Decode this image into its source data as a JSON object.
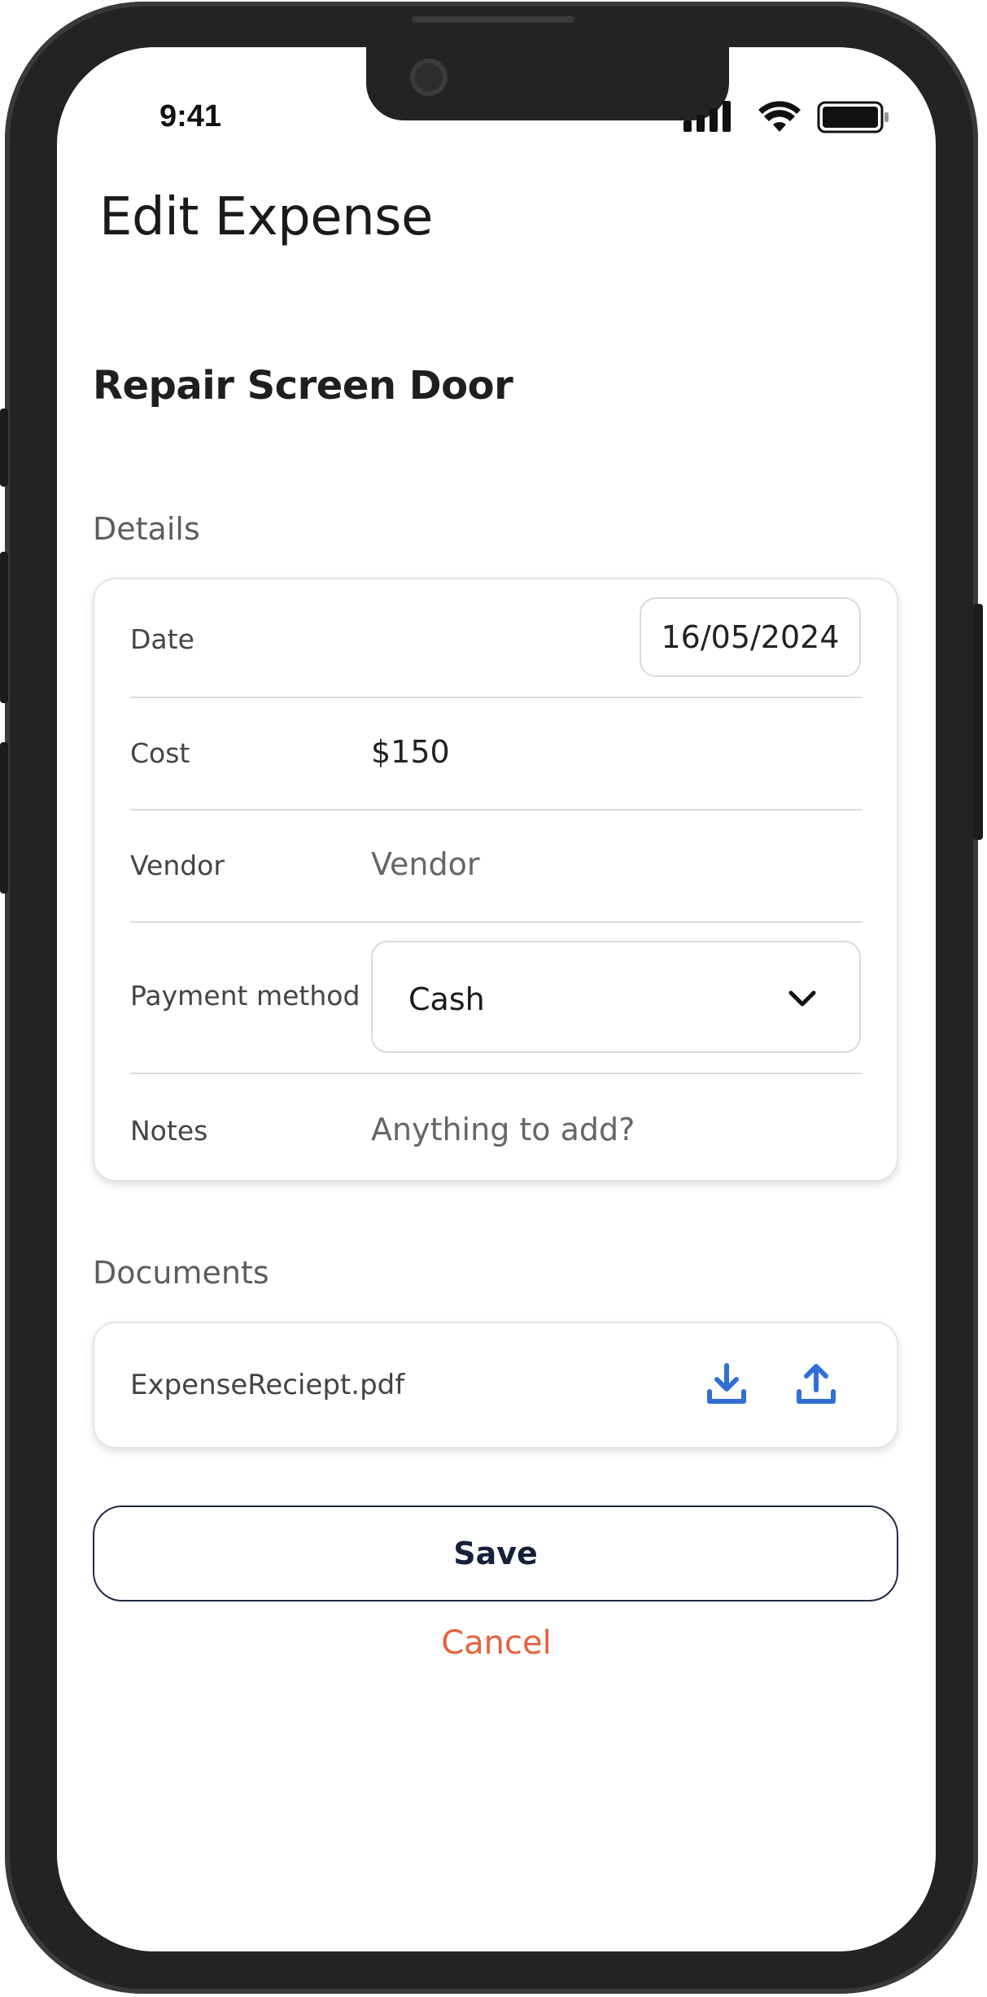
{
  "status_bar": {
    "time": "9:41"
  },
  "header": {
    "title": "Edit Expense"
  },
  "expense": {
    "name": "Repair Screen Door"
  },
  "details": {
    "section_label": "Details",
    "date": {
      "label": "Date",
      "value": "16/05/2024"
    },
    "cost": {
      "label": "Cost",
      "value": "$150"
    },
    "vendor": {
      "label": "Vendor",
      "placeholder": "Vendor"
    },
    "payment_method": {
      "label": "Payment method",
      "selected": "Cash"
    },
    "notes": {
      "label": "Notes",
      "placeholder": "Anything to add?"
    }
  },
  "documents": {
    "section_label": "Documents",
    "file_name": "ExpenseReciept.pdf",
    "download_icon": "download-icon",
    "upload_icon": "upload-icon"
  },
  "actions": {
    "save_label": "Save",
    "cancel_label": "Cancel"
  },
  "colors": {
    "accent_blue": "#2f6fd6",
    "cancel_orange": "#e8623a",
    "save_border": "#1f2a44",
    "frame": "#232323"
  }
}
